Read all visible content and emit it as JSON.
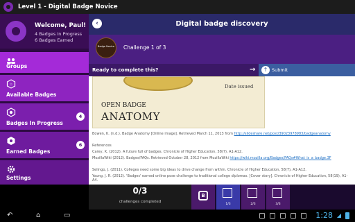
{
  "app": {
    "title": "Level 1 - Digital Badge Novice"
  },
  "profile": {
    "welcome": "Welcome, Paul!",
    "badges_in_progress": "4 Badges In Progress",
    "badges_earned": "6 Badges Earned"
  },
  "sidebar": {
    "items": [
      {
        "label": "Groups",
        "icon": "groups-icon",
        "badge": ""
      },
      {
        "label": "Available Badges",
        "icon": "badge-outline-icon",
        "badge": ""
      },
      {
        "label": "Badges In Progress",
        "icon": "badge-progress-icon",
        "badge": "4"
      },
      {
        "label": "Earned Badges",
        "icon": "badge-earned-icon",
        "badge": "6"
      },
      {
        "label": "Settings",
        "icon": "gear-icon",
        "badge": ""
      }
    ]
  },
  "main": {
    "title": "Digital badge discovery",
    "badge_thumb_label": "Badge Novice",
    "challenge_label": "Challenge 1 of 3",
    "ready_prompt": "Ready to complete this?",
    "submit_label": "Submit",
    "image": {
      "date_text": "Date issued",
      "title_line1": "OPEN BADGE",
      "title_line2": "ANATOMY"
    },
    "references": [
      {
        "text": "Bowen, K. (n.d.). Badge Anatomy [Online image]. Retrieved March 11, 2013 from ",
        "link": "http://slideshare.net/post/39023978983/badgeanatomy"
      },
      {
        "text": "References",
        "link": ""
      },
      {
        "text": "Carey, K. (2012). A future full of badges. Chronicle of Higher Education, 58(7), A1-A12.",
        "link": ""
      },
      {
        "text": "MozillaWiki (2012). Badges/FAQs. Retrieved October 28, 2012 from MozillaWiki ",
        "link": "https://wiki.mozilla.org/Badges/FAQs#What_is_a_badge.3F"
      },
      {
        "text": "Selingo, J. (2011). Colleges need some big ideas to drive change from within. Chronicle of Higher Education, 58(7), A1-A12.",
        "link": ""
      },
      {
        "text": "Young, J. R. (2012). 'Badges' earned online pose challenge to traditional college diplomas. [Cover story]. Chronicle of Higher Education, 58(19), A1-A4.",
        "link": ""
      }
    ]
  },
  "progress": {
    "count": "0/3",
    "label": "challenges completed",
    "steps": [
      "1/3",
      "2/3",
      "3/3"
    ],
    "badge_letter": "B"
  },
  "system": {
    "clock": "1:28"
  }
}
